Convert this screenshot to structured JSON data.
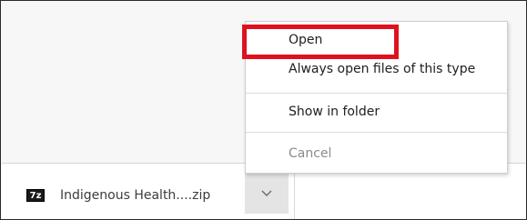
{
  "download": {
    "file_icon_text": "7z",
    "file_name": "Indigenous Health....zip"
  },
  "menu": {
    "items": [
      {
        "label": "Open"
      },
      {
        "label": "Always open files of this type"
      },
      {
        "label": "Show in folder"
      },
      {
        "label": "Cancel",
        "disabled": true
      }
    ]
  },
  "icons": {
    "dropdown": "chevron-down-icon",
    "file": "7zip-file-icon"
  },
  "colors": {
    "highlight": "#e0111e",
    "disabled_text": "#8a8a8a"
  }
}
